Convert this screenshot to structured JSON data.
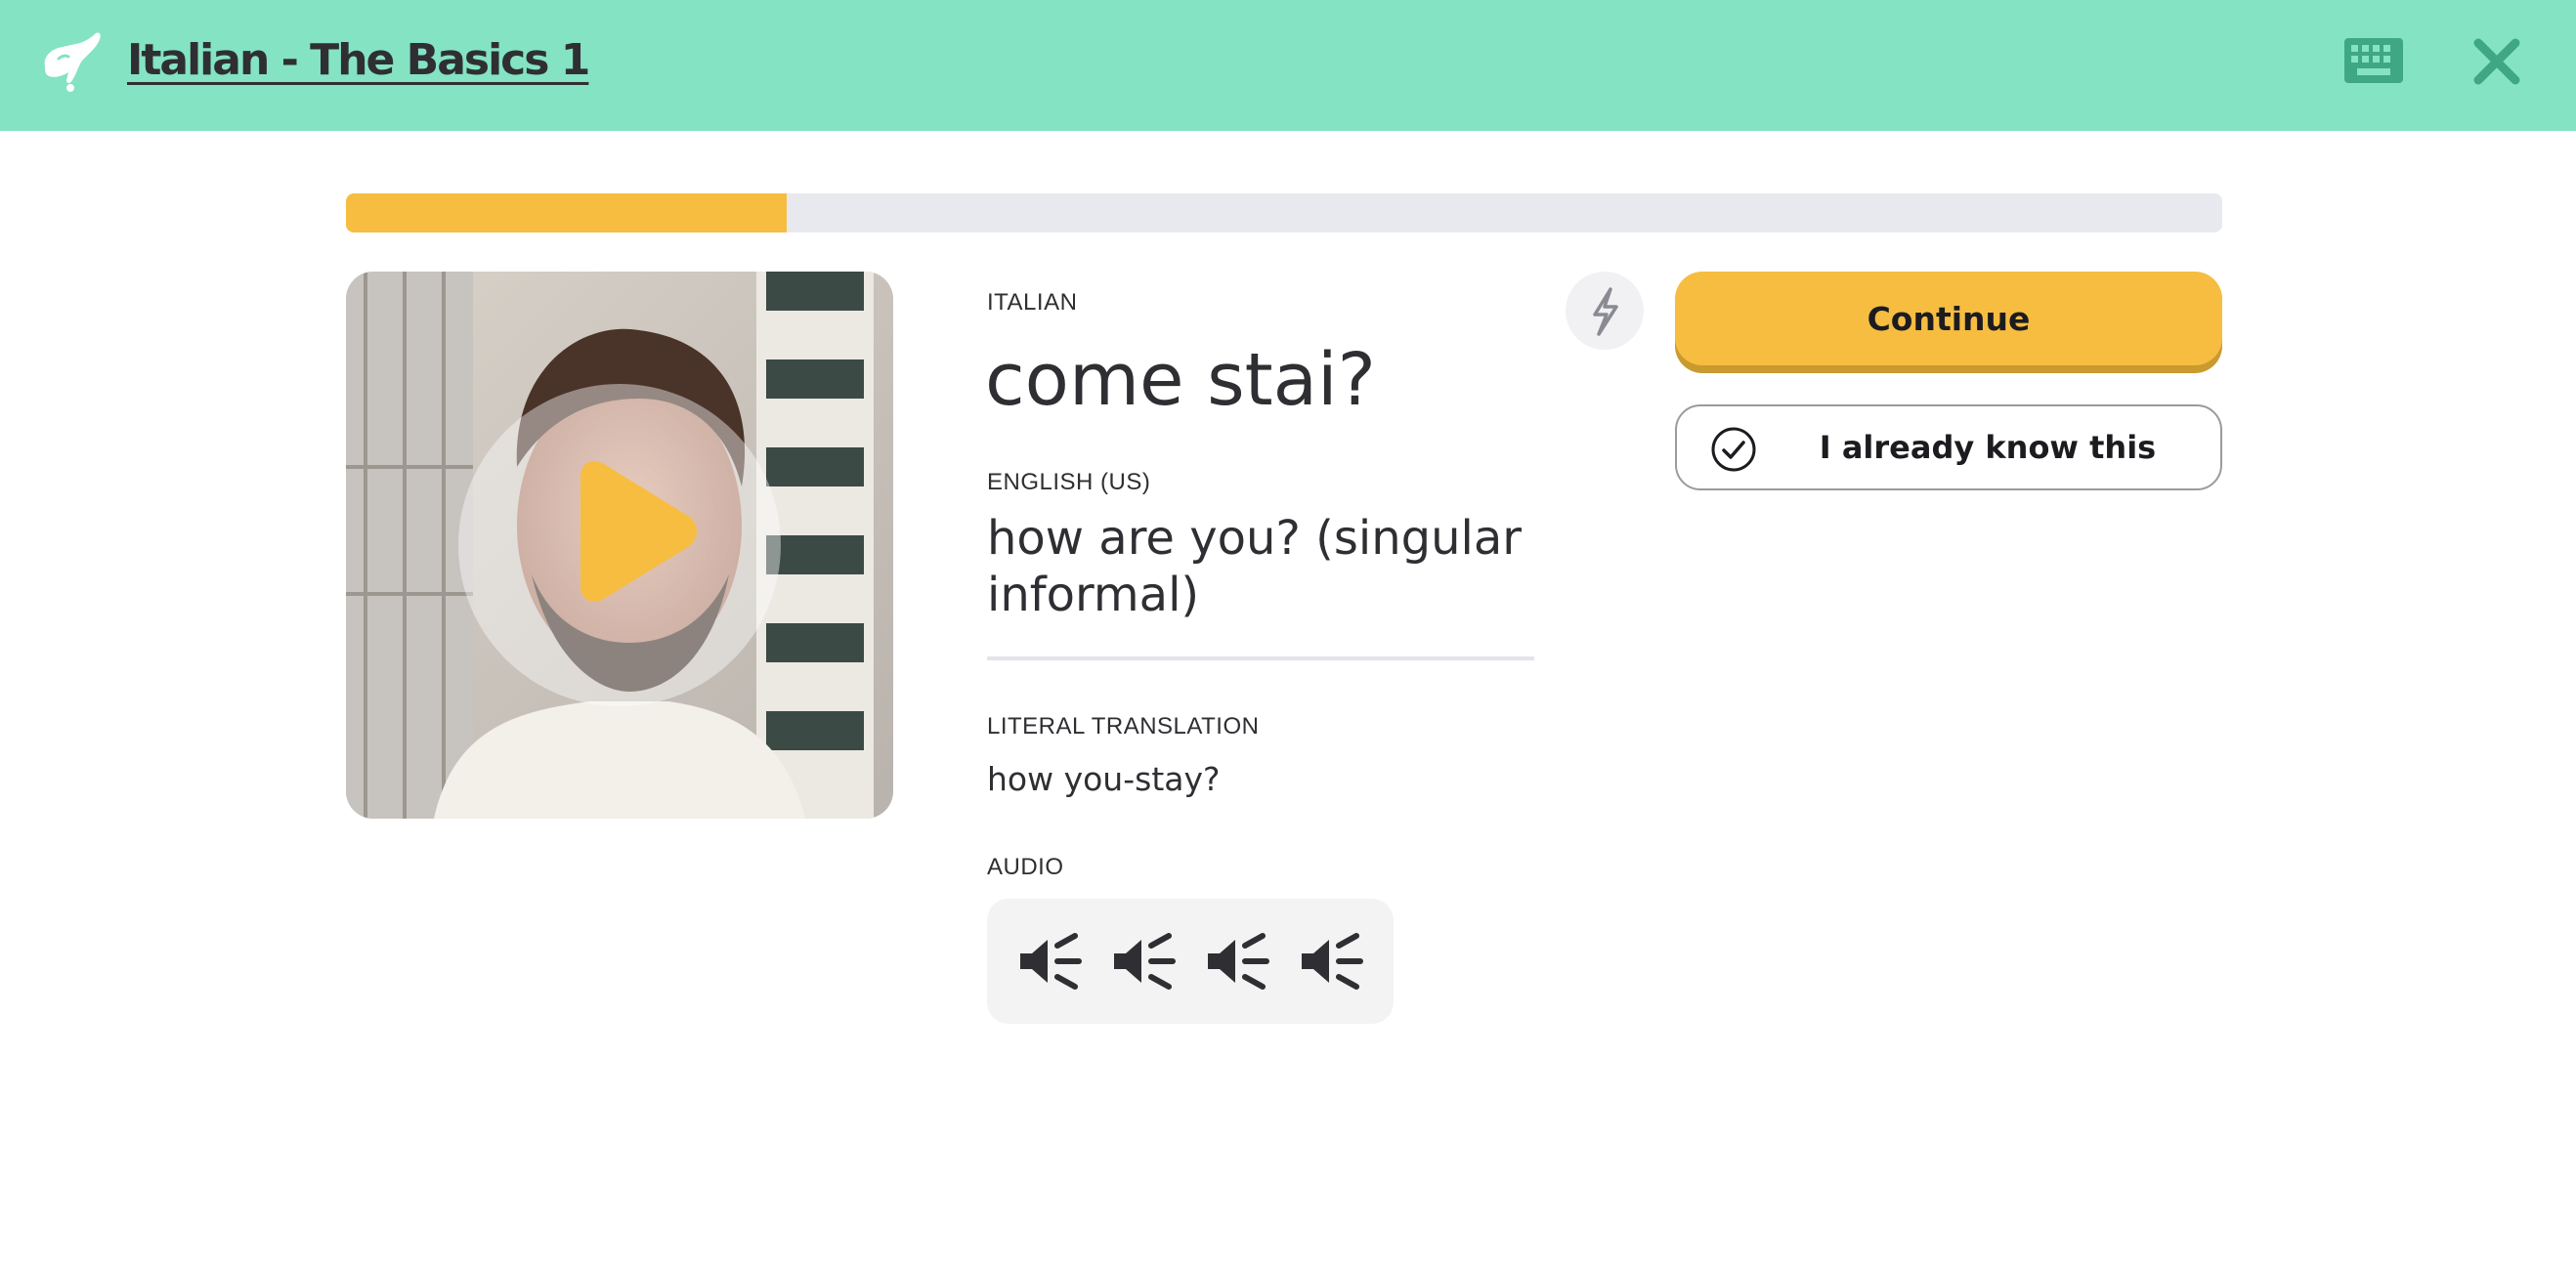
{
  "header": {
    "course_title": "Italian - The Basics 1",
    "background_color": "#84e3c2",
    "logo_icon": "hand-icon",
    "keyboard_icon": "keyboard-icon",
    "close_icon": "close-icon"
  },
  "progress": {
    "fraction": 0.235,
    "fill_color": "#f6bd41",
    "track_color": "#e8e9ee"
  },
  "video": {
    "play_icon": "play-icon",
    "description": "video thumbnail"
  },
  "card": {
    "source_label": "ITALIAN",
    "source_phrase": "come stai?",
    "target_label": "ENGLISH (US)",
    "target_phrase": "how are you? (singular informal)",
    "literal_label": "LITERAL TRANSLATION",
    "literal_text": "how you-stay?",
    "audio_label": "AUDIO",
    "audio_icons": [
      "speaker-icon",
      "speaker-icon",
      "speaker-icon",
      "speaker-icon"
    ]
  },
  "actions": {
    "difficulty_icon": "lightning-icon",
    "continue_label": "Continue",
    "already_know_label": "I already know this",
    "accent_color": "#f6bd41"
  }
}
